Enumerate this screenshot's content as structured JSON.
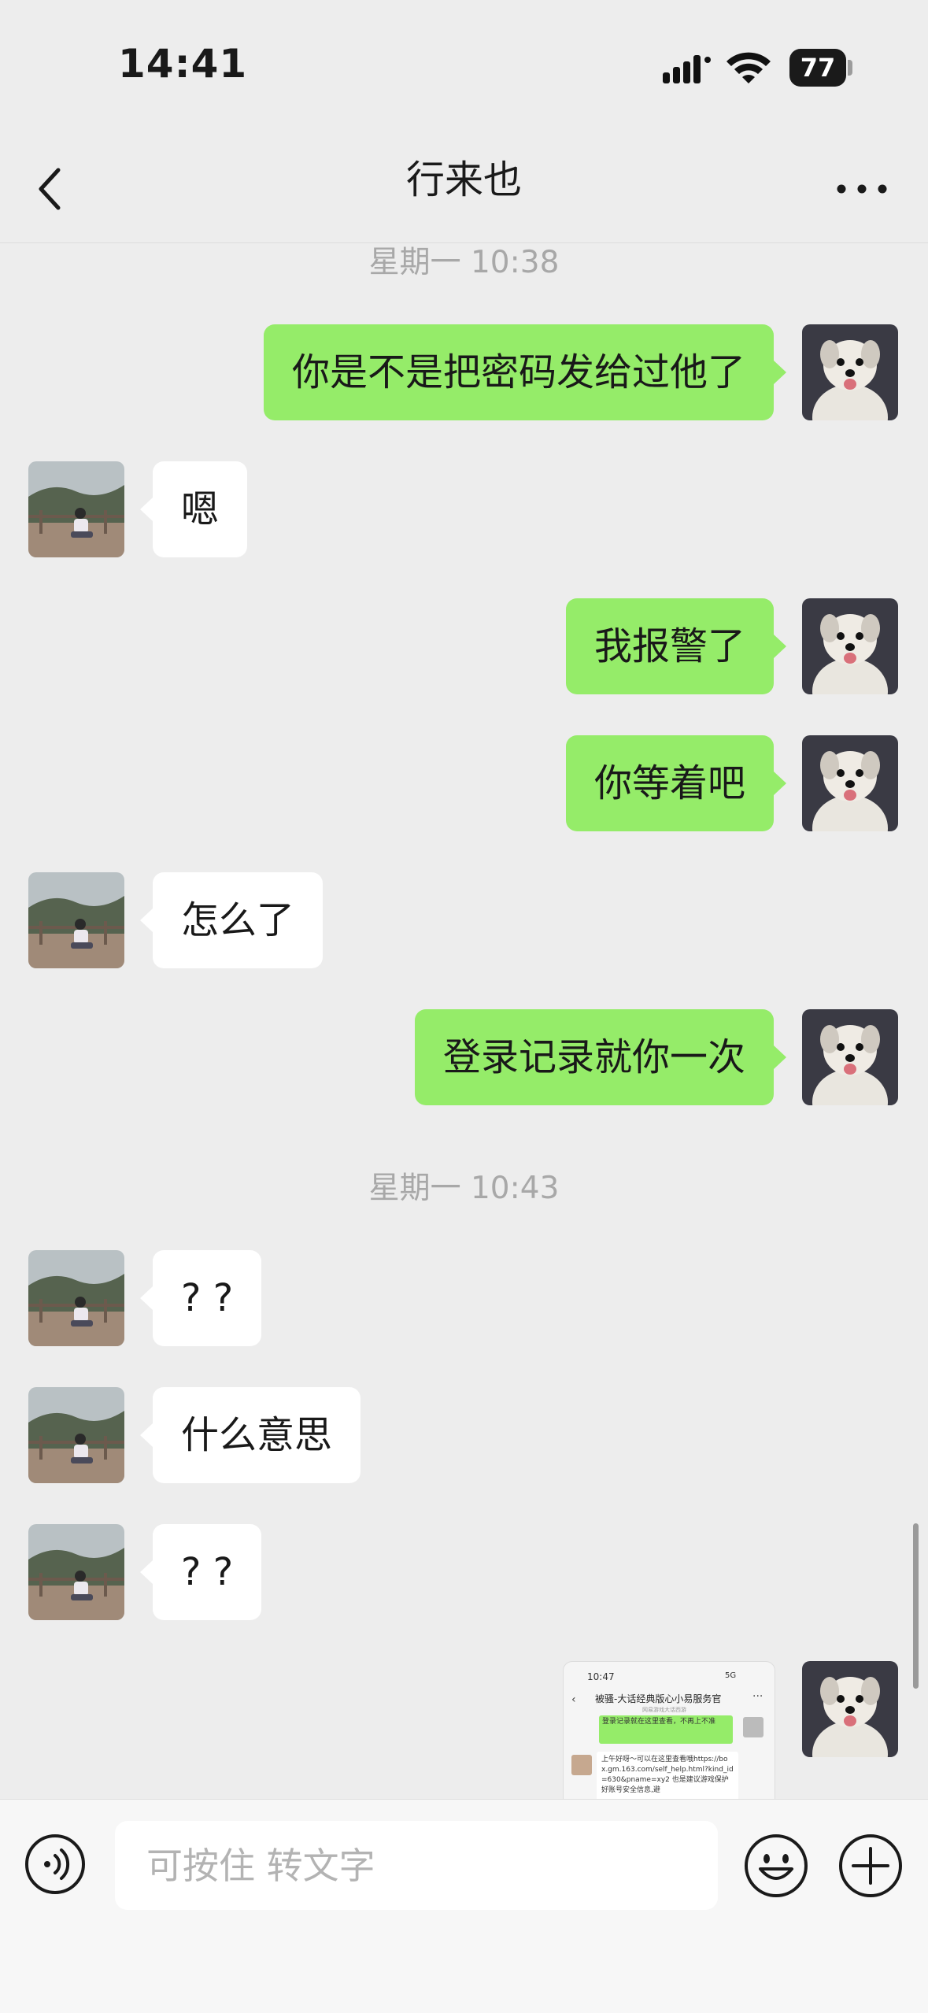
{
  "status_bar": {
    "time": "14:41",
    "battery": "77"
  },
  "header": {
    "title": "行来也"
  },
  "messages": [
    {
      "type": "timestamp",
      "text": "星期一 10:38"
    },
    {
      "type": "text",
      "direction": "out",
      "text": "你是不是把密码发给过他了"
    },
    {
      "type": "text",
      "direction": "in",
      "text": "嗯"
    },
    {
      "type": "text",
      "direction": "out",
      "text": "我报警了"
    },
    {
      "type": "text",
      "direction": "out",
      "text": "你等着吧"
    },
    {
      "type": "text",
      "direction": "in",
      "text": "怎么了"
    },
    {
      "type": "text",
      "direction": "out",
      "text": "登录记录就你一次"
    },
    {
      "type": "timestamp",
      "text": "星期一 10:43"
    },
    {
      "type": "text",
      "direction": "in",
      "text": "? ?"
    },
    {
      "type": "text",
      "direction": "in",
      "text": "什么意思"
    },
    {
      "type": "text",
      "direction": "in",
      "text": "? ?"
    },
    {
      "type": "image",
      "direction": "out",
      "screenshot": {
        "time": "10:47",
        "status": "5G",
        "title": "被骚-大话经典版心小易服务官",
        "subtitle": "网易游戏大话西游",
        "green_text": "登录记录就在这里查看，不再上不准",
        "white_text": "上午好呀～可以在这里查看哦https://box.gm.163.com/self_help.html?kind_id=630&pname=xy2 也是建议游戏保护好账号安全信息,避"
      }
    }
  ],
  "input": {
    "placeholder": "可按住 转文字"
  }
}
